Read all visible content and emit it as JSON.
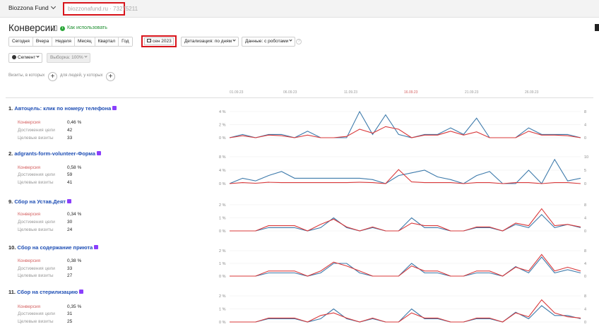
{
  "header": {
    "app_name": "Biozzona Fund",
    "site": "biozzonafund.ru · 73275211"
  },
  "page": {
    "title": "Конверсии",
    "how_to": "Как использовать"
  },
  "toolbar": {
    "periods": [
      "Сегодня",
      "Вчера",
      "Неделя",
      "Месяц",
      "Квартал",
      "Год"
    ],
    "date_range": "сен 2023",
    "detail": "Детализация: по дням",
    "data": "Данные: с роботами",
    "help": "?"
  },
  "filters": {
    "segment": "Сегмент",
    "sample": "Выборка: 100%",
    "visits_label": "Визиты, в которых",
    "people_label": "для людей, у которых",
    "plus": "+"
  },
  "timeline": {
    "dates": [
      "01.09.23",
      "06.09.23",
      "11.09.23",
      "16.09.23",
      "21.09.23",
      "26.09.23"
    ],
    "highlight_index": 3
  },
  "metric_labels": {
    "conversion": "Конверсия",
    "achievements": "Достижения цели",
    "target_visits": "Целевые визиты"
  },
  "colors": {
    "conversion_line": "#d9383a",
    "visits_line": "#3d7aab",
    "link": "#1f4fb5",
    "highlight_red": "#d8141b",
    "goal_icon": "#8a3ffc"
  },
  "goals": [
    {
      "index": "1.",
      "name": "Автоцель: клик по номеру телефона",
      "conversion": "0,46 %",
      "achievements": "42",
      "target_visits": "33",
      "left_ticks": [
        "4 %",
        "2 %",
        "0 %"
      ],
      "right_ticks": [
        "8",
        "4",
        "0"
      ],
      "conversion_series": [
        0,
        0.3,
        0,
        0.4,
        0.3,
        0,
        0.4,
        0,
        0,
        0.2,
        1.3,
        0.7,
        1.7,
        1.3,
        0,
        0.4,
        0.4,
        1.0,
        0.4,
        0.9,
        0,
        0,
        0,
        1.0,
        0.4,
        0.4,
        0.3,
        0
      ],
      "visits_series": [
        0,
        1,
        0,
        1,
        1,
        0,
        2,
        0,
        0,
        0,
        8,
        1,
        7,
        1,
        0,
        1,
        1,
        3,
        1,
        6,
        0,
        0,
        0,
        3,
        1,
        1,
        1,
        0
      ]
    },
    {
      "index": "2.",
      "name": "adgrants-form-volunteer-Форма",
      "conversion": "0,58 %",
      "achievements": "59",
      "target_visits": "41",
      "left_ticks": [
        "8 %",
        "4 %",
        "0 %"
      ],
      "right_ticks": [
        "10",
        "5",
        "0"
      ],
      "conversion_series": [
        0,
        0.3,
        0.1,
        0.4,
        0.3,
        0.3,
        0.3,
        0.3,
        0.3,
        0.3,
        0.4,
        0.3,
        0,
        4.2,
        0.5,
        0.3,
        0.3,
        0.3,
        0,
        0.3,
        0.3,
        0,
        0.3,
        0.3,
        0,
        0.3,
        0.3,
        0
      ],
      "visits_series": [
        0,
        2,
        1,
        3,
        4.5,
        2,
        2,
        2,
        2,
        2,
        2,
        1.5,
        0,
        3,
        4,
        5,
        2.5,
        1.5,
        0,
        3,
        4.5,
        0,
        0,
        5,
        0,
        9,
        1,
        2
      ]
    },
    {
      "index": "9.",
      "name": "Сбор на Устав.Деят",
      "conversion": "0,34 %",
      "achievements": "30",
      "target_visits": "24",
      "left_ticks": [
        "2 %",
        "1 %",
        "0 %"
      ],
      "right_ticks": [
        "8",
        "4",
        "0"
      ],
      "conversion_series": [
        0,
        0,
        0,
        0.4,
        0.4,
        0.4,
        0,
        0.5,
        0.9,
        0.3,
        0,
        0.3,
        0,
        0,
        0.6,
        0.4,
        0.4,
        0,
        0,
        0.3,
        0.3,
        0,
        0.6,
        0.4,
        1.7,
        0.4,
        0.5,
        0.3
      ],
      "visits_series": [
        0,
        0,
        0,
        1,
        1,
        1,
        0,
        1,
        4,
        1,
        0,
        1,
        0,
        0,
        4,
        1,
        1,
        0,
        0,
        1,
        1,
        0,
        2,
        1,
        5,
        1,
        2,
        1
      ]
    },
    {
      "index": "10.",
      "name": "Сбор на содержание приюта",
      "conversion": "0,38 %",
      "achievements": "33",
      "target_visits": "27",
      "left_ticks": [
        "2 %",
        "1 %",
        "0 %"
      ],
      "right_ticks": [
        "8",
        "4",
        "0"
      ],
      "conversion_series": [
        0,
        0,
        0,
        0.4,
        0.4,
        0.4,
        0,
        0.4,
        1.1,
        0.8,
        0.4,
        0,
        0,
        0,
        0.8,
        0.4,
        0.4,
        0,
        0,
        0.4,
        0.4,
        0,
        0.7,
        0.4,
        1.7,
        0.4,
        0.7,
        0.4
      ],
      "visits_series": [
        0,
        0,
        0,
        1,
        1,
        1,
        0,
        1,
        4,
        4,
        1,
        0,
        0,
        0,
        4,
        1,
        1,
        0,
        0,
        1,
        1,
        0,
        3,
        1,
        6,
        1,
        2,
        1
      ]
    },
    {
      "index": "11.",
      "name": "Сбор на стерилизацию",
      "conversion": "0,35 %",
      "achievements": "31",
      "target_visits": "25",
      "left_ticks": [
        "2 %",
        "1 %",
        "0 %"
      ],
      "right_ticks": [
        "8",
        "4",
        "0"
      ],
      "conversion_series": [
        0,
        0,
        0,
        0.3,
        0.3,
        0.3,
        0,
        0.5,
        0.7,
        0.3,
        0,
        0.3,
        0,
        0,
        0.7,
        0.3,
        0.3,
        0,
        0,
        0.3,
        0.3,
        0,
        0.7,
        0.4,
        1.7,
        0.7,
        0.4,
        0.3
      ],
      "visits_series": [
        0,
        0,
        0,
        1,
        1,
        1,
        0,
        1,
        4,
        1,
        0,
        1,
        0,
        0,
        4,
        1,
        1,
        0,
        0,
        1,
        1,
        0,
        3,
        1,
        5,
        2,
        2,
        1
      ]
    }
  ]
}
